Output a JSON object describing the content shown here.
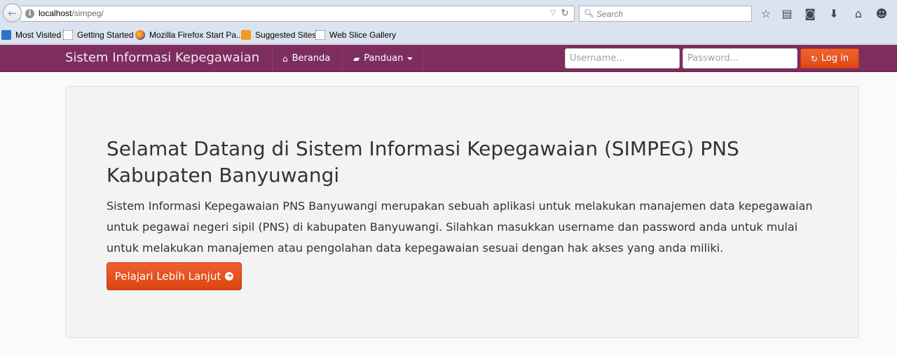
{
  "browser": {
    "url_host": "localhost",
    "url_path": "/simpeg/",
    "search_placeholder": "Search",
    "bookmarks": [
      {
        "label": "Most Visited"
      },
      {
        "label": "Getting Started"
      },
      {
        "label": "Mozilla Firefox Start Pa..."
      },
      {
        "label": "Suggested Sites"
      },
      {
        "label": "Web Slice Gallery"
      }
    ]
  },
  "navbar": {
    "brand": "Sistem Informasi Kepegawaian",
    "links": [
      {
        "label": "Beranda",
        "icon": "home-icon"
      },
      {
        "label": "Panduan",
        "icon": "comment-icon"
      }
    ],
    "username_placeholder": "Username...",
    "password_placeholder": "Password...",
    "login_label": "Log in",
    "accent_color": "#7d2d5e"
  },
  "hero": {
    "title": "Selamat Datang di Sistem Informasi Kepegawaian (SIMPEG) PNS Kabupaten Banyuwangi",
    "description": "Sistem Informasi Kepegawaian PNS Banyuwangi merupakan sebuah aplikasi untuk melakukan manajemen data kepegawaian untuk pegawai negeri sipil (PNS) di kabupaten Banyuwangi. Silahkan masukkan username dan password anda untuk mulai untuk melakukan manajemen atau pengolahan data kepegawaian sesuai dengan hak akses yang anda miliki.",
    "button_label": "Pelajari Lebih Lanjut",
    "button_color": "#dd4814"
  }
}
